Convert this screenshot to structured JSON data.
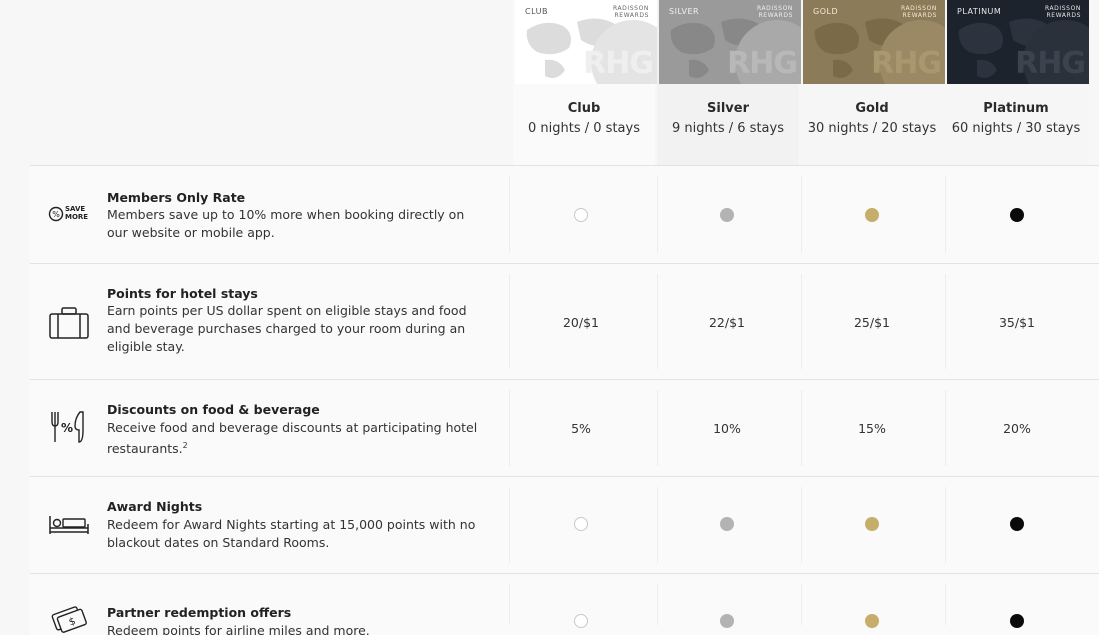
{
  "tiers": [
    {
      "card_name": "CLUB",
      "brand": "RADISSON REWARDS",
      "logo": "RHG",
      "name": "Club",
      "requirement": "0 nights / 0 stays",
      "dot_color": "#ffffff"
    },
    {
      "card_name": "SILVER",
      "brand": "RADISSON REWARDS",
      "logo": "RHG",
      "name": "Silver",
      "requirement": "9 nights / 6 stays",
      "dot_color": "#b3b3b3"
    },
    {
      "card_name": "GOLD",
      "brand": "RADISSON REWARDS",
      "logo": "RHG",
      "name": "Gold",
      "requirement": "30 nights / 20 stays",
      "dot_color": "#c7ad6b"
    },
    {
      "card_name": "PLATINUM",
      "brand": "RADISSON REWARDS",
      "logo": "RHG",
      "name": "Platinum",
      "requirement": "60 nights / 30 stays",
      "dot_color": "#0a0a0a"
    }
  ],
  "benefits": [
    {
      "title": "Members Only Rate",
      "description": "Members save up to 10% more when booking directly on our website or mobile app.",
      "icon_text": "SAVE MORE",
      "icon": "save-more-icon",
      "values": [
        "dot",
        "dot",
        "dot",
        "dot"
      ]
    },
    {
      "title": "Points for hotel stays",
      "description": "Earn points per US dollar spent on eligible stays and food and beverage purchases charged to your room during an eligible stay.",
      "icon": "suitcase-icon",
      "values": [
        "20/$1",
        "22/$1",
        "25/$1",
        "35/$1"
      ]
    },
    {
      "title": "Discounts on food & beverage",
      "description": "Receive food and beverage discounts at participating hotel restaurants.",
      "footnote": "2",
      "icon_text": "%",
      "icon": "food-discount-icon",
      "values": [
        "5%",
        "10%",
        "15%",
        "20%"
      ]
    },
    {
      "title": "Award Nights",
      "description": "Redeem for Award Nights starting at 15,000 points with no blackout dates on Standard Rooms.",
      "icon": "bed-icon",
      "values": [
        "dot",
        "dot",
        "dot",
        "dot"
      ]
    },
    {
      "title": "Partner redemption offers",
      "description": "Redeem points for airline miles and more.",
      "icon": "tickets-icon",
      "values": [
        "dot",
        "dot",
        "dot",
        "dot"
      ]
    }
  ]
}
